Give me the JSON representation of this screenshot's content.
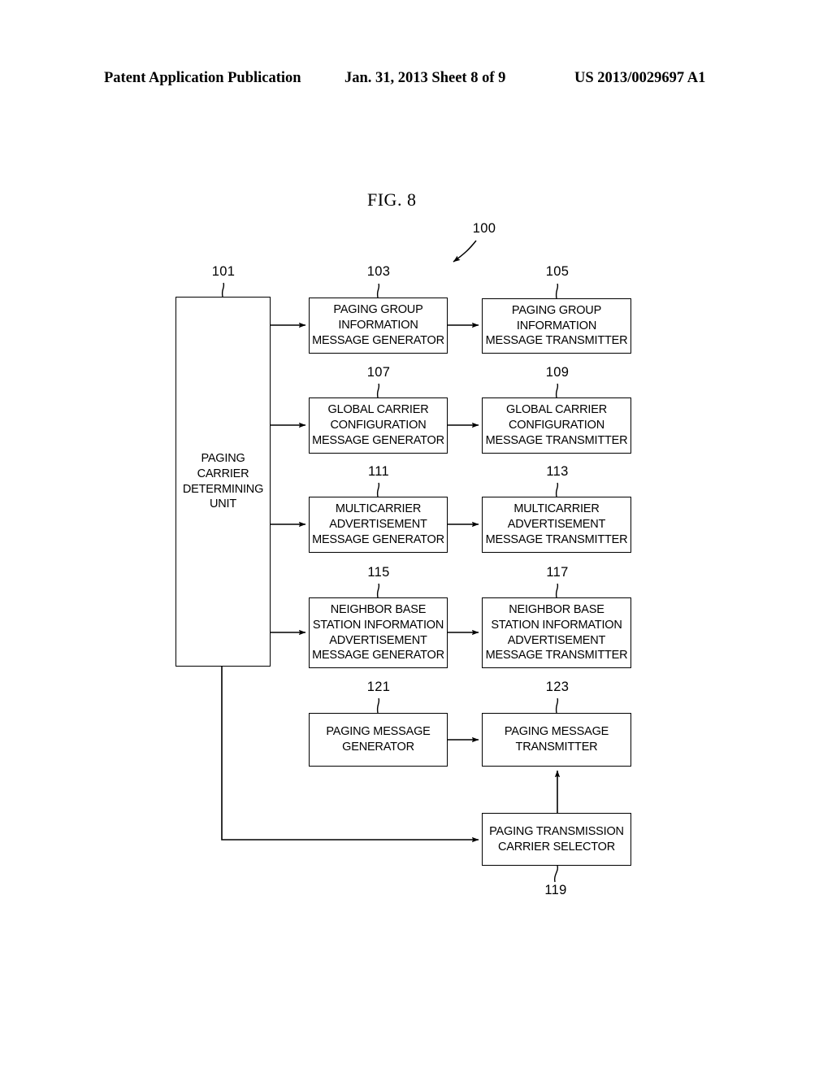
{
  "header": {
    "left": "Patent Application Publication",
    "center": "Jan. 31, 2013  Sheet 8 of 9",
    "right": "US 2013/0029697 A1"
  },
  "figure": {
    "title": "FIG. 8",
    "system_ref": "100"
  },
  "nodes": {
    "determining_unit": {
      "ref": "101",
      "label": "PAGING\nCARRIER\nDETERMINING\nUNIT"
    },
    "paging_group_generator": {
      "ref": "103",
      "label": "PAGING GROUP\nINFORMATION\nMESSAGE GENERATOR"
    },
    "paging_group_transmitter": {
      "ref": "105",
      "label": "PAGING GROUP\nINFORMATION\nMESSAGE TRANSMITTER"
    },
    "global_carrier_generator": {
      "ref": "107",
      "label": "GLOBAL CARRIER\nCONFIGURATION\nMESSAGE GENERATOR"
    },
    "global_carrier_transmitter": {
      "ref": "109",
      "label": "GLOBAL CARRIER\nCONFIGURATION\nMESSAGE TRANSMITTER"
    },
    "multicarrier_generator": {
      "ref": "111",
      "label": "MULTICARRIER\nADVERTISEMENT\nMESSAGE GENERATOR"
    },
    "multicarrier_transmitter": {
      "ref": "113",
      "label": "MULTICARRIER\nADVERTISEMENT\nMESSAGE TRANSMITTER"
    },
    "neighbor_generator": {
      "ref": "115",
      "label": "NEIGHBOR BASE\nSTATION INFORMATION\nADVERTISEMENT\nMESSAGE GENERATOR"
    },
    "neighbor_transmitter": {
      "ref": "117",
      "label": "NEIGHBOR BASE\nSTATION INFORMATION\nADVERTISEMENT\nMESSAGE TRANSMITTER"
    },
    "paging_message_generator": {
      "ref": "121",
      "label": "PAGING MESSAGE\nGENERATOR"
    },
    "paging_message_transmitter": {
      "ref": "123",
      "label": "PAGING MESSAGE\nTRANSMITTER"
    },
    "carrier_selector": {
      "ref": "119",
      "label": "PAGING TRANSMISSION\nCARRIER SELECTOR"
    }
  },
  "colors": {
    "ink": "#000000",
    "paper": "#ffffff"
  }
}
